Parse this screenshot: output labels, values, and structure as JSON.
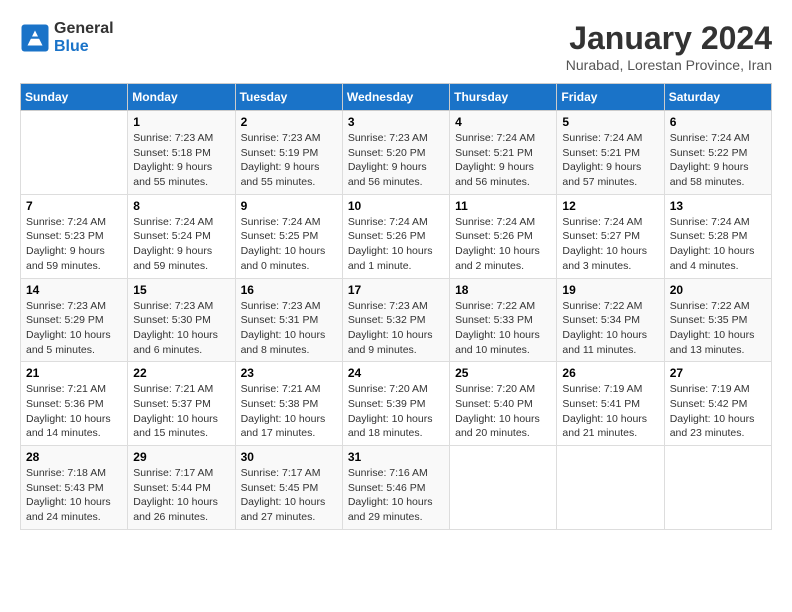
{
  "header": {
    "logo_line1": "General",
    "logo_line2": "Blue",
    "month": "January 2024",
    "location": "Nurabad, Lorestan Province, Iran"
  },
  "days_of_week": [
    "Sunday",
    "Monday",
    "Tuesday",
    "Wednesday",
    "Thursday",
    "Friday",
    "Saturday"
  ],
  "weeks": [
    [
      {
        "day": "",
        "detail": ""
      },
      {
        "day": "1",
        "detail": "Sunrise: 7:23 AM\nSunset: 5:18 PM\nDaylight: 9 hours\nand 55 minutes."
      },
      {
        "day": "2",
        "detail": "Sunrise: 7:23 AM\nSunset: 5:19 PM\nDaylight: 9 hours\nand 55 minutes."
      },
      {
        "day": "3",
        "detail": "Sunrise: 7:23 AM\nSunset: 5:20 PM\nDaylight: 9 hours\nand 56 minutes."
      },
      {
        "day": "4",
        "detail": "Sunrise: 7:24 AM\nSunset: 5:21 PM\nDaylight: 9 hours\nand 56 minutes."
      },
      {
        "day": "5",
        "detail": "Sunrise: 7:24 AM\nSunset: 5:21 PM\nDaylight: 9 hours\nand 57 minutes."
      },
      {
        "day": "6",
        "detail": "Sunrise: 7:24 AM\nSunset: 5:22 PM\nDaylight: 9 hours\nand 58 minutes."
      }
    ],
    [
      {
        "day": "7",
        "detail": "Sunrise: 7:24 AM\nSunset: 5:23 PM\nDaylight: 9 hours\nand 59 minutes."
      },
      {
        "day": "8",
        "detail": "Sunrise: 7:24 AM\nSunset: 5:24 PM\nDaylight: 9 hours\nand 59 minutes."
      },
      {
        "day": "9",
        "detail": "Sunrise: 7:24 AM\nSunset: 5:25 PM\nDaylight: 10 hours\nand 0 minutes."
      },
      {
        "day": "10",
        "detail": "Sunrise: 7:24 AM\nSunset: 5:26 PM\nDaylight: 10 hours\nand 1 minute."
      },
      {
        "day": "11",
        "detail": "Sunrise: 7:24 AM\nSunset: 5:26 PM\nDaylight: 10 hours\nand 2 minutes."
      },
      {
        "day": "12",
        "detail": "Sunrise: 7:24 AM\nSunset: 5:27 PM\nDaylight: 10 hours\nand 3 minutes."
      },
      {
        "day": "13",
        "detail": "Sunrise: 7:24 AM\nSunset: 5:28 PM\nDaylight: 10 hours\nand 4 minutes."
      }
    ],
    [
      {
        "day": "14",
        "detail": "Sunrise: 7:23 AM\nSunset: 5:29 PM\nDaylight: 10 hours\nand 5 minutes."
      },
      {
        "day": "15",
        "detail": "Sunrise: 7:23 AM\nSunset: 5:30 PM\nDaylight: 10 hours\nand 6 minutes."
      },
      {
        "day": "16",
        "detail": "Sunrise: 7:23 AM\nSunset: 5:31 PM\nDaylight: 10 hours\nand 8 minutes."
      },
      {
        "day": "17",
        "detail": "Sunrise: 7:23 AM\nSunset: 5:32 PM\nDaylight: 10 hours\nand 9 minutes."
      },
      {
        "day": "18",
        "detail": "Sunrise: 7:22 AM\nSunset: 5:33 PM\nDaylight: 10 hours\nand 10 minutes."
      },
      {
        "day": "19",
        "detail": "Sunrise: 7:22 AM\nSunset: 5:34 PM\nDaylight: 10 hours\nand 11 minutes."
      },
      {
        "day": "20",
        "detail": "Sunrise: 7:22 AM\nSunset: 5:35 PM\nDaylight: 10 hours\nand 13 minutes."
      }
    ],
    [
      {
        "day": "21",
        "detail": "Sunrise: 7:21 AM\nSunset: 5:36 PM\nDaylight: 10 hours\nand 14 minutes."
      },
      {
        "day": "22",
        "detail": "Sunrise: 7:21 AM\nSunset: 5:37 PM\nDaylight: 10 hours\nand 15 minutes."
      },
      {
        "day": "23",
        "detail": "Sunrise: 7:21 AM\nSunset: 5:38 PM\nDaylight: 10 hours\nand 17 minutes."
      },
      {
        "day": "24",
        "detail": "Sunrise: 7:20 AM\nSunset: 5:39 PM\nDaylight: 10 hours\nand 18 minutes."
      },
      {
        "day": "25",
        "detail": "Sunrise: 7:20 AM\nSunset: 5:40 PM\nDaylight: 10 hours\nand 20 minutes."
      },
      {
        "day": "26",
        "detail": "Sunrise: 7:19 AM\nSunset: 5:41 PM\nDaylight: 10 hours\nand 21 minutes."
      },
      {
        "day": "27",
        "detail": "Sunrise: 7:19 AM\nSunset: 5:42 PM\nDaylight: 10 hours\nand 23 minutes."
      }
    ],
    [
      {
        "day": "28",
        "detail": "Sunrise: 7:18 AM\nSunset: 5:43 PM\nDaylight: 10 hours\nand 24 minutes."
      },
      {
        "day": "29",
        "detail": "Sunrise: 7:17 AM\nSunset: 5:44 PM\nDaylight: 10 hours\nand 26 minutes."
      },
      {
        "day": "30",
        "detail": "Sunrise: 7:17 AM\nSunset: 5:45 PM\nDaylight: 10 hours\nand 27 minutes."
      },
      {
        "day": "31",
        "detail": "Sunrise: 7:16 AM\nSunset: 5:46 PM\nDaylight: 10 hours\nand 29 minutes."
      },
      {
        "day": "",
        "detail": ""
      },
      {
        "day": "",
        "detail": ""
      },
      {
        "day": "",
        "detail": ""
      }
    ]
  ]
}
